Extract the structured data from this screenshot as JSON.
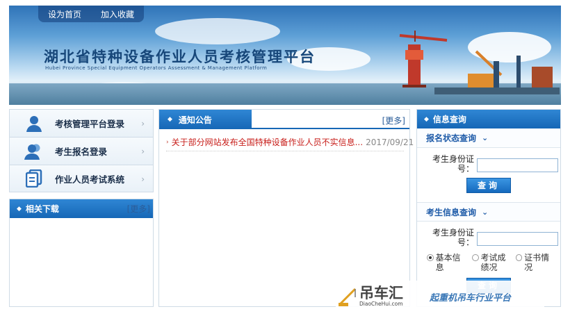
{
  "header": {
    "nav": [
      "设为首页",
      "加入收藏"
    ],
    "title_cn": "湖北省特种设备作业人员考核管理平台",
    "title_en": "Hubei Province Special Equipment Operators Assessment & Management Platform"
  },
  "left_menu": [
    {
      "label": "考核管理平台登录",
      "icon": "user-icon"
    },
    {
      "label": "考生报名登录",
      "icon": "users-icon"
    },
    {
      "label": "作业人员考试系统",
      "icon": "document-icon"
    }
  ],
  "downloads": {
    "title": "相关下载",
    "more": "[更多]"
  },
  "notice": {
    "title": "通知公告",
    "more": "[更多]",
    "items": [
      {
        "text": "关于部分网站发布全国特种设备作业人员不实信息...",
        "date": "2017/09/21"
      }
    ]
  },
  "info_query": {
    "title": "信息查询",
    "status_section": {
      "title": "报名状态查询",
      "id_label": "考生身份证号：",
      "id_value": "",
      "button": "查询"
    },
    "student_section": {
      "title": "考生信息查询",
      "id_label": "考生身份证号：",
      "id_value": "",
      "options": [
        {
          "label": "基本信息",
          "selected": true
        },
        {
          "label": "考试成绩况",
          "selected": false
        },
        {
          "label": "证书情况",
          "selected": false
        }
      ],
      "button": "查询"
    }
  },
  "watermark": {
    "logo": "吊车汇",
    "url": "DiaoCheHui.com",
    "slogan": "起重机吊车行业平台"
  }
}
